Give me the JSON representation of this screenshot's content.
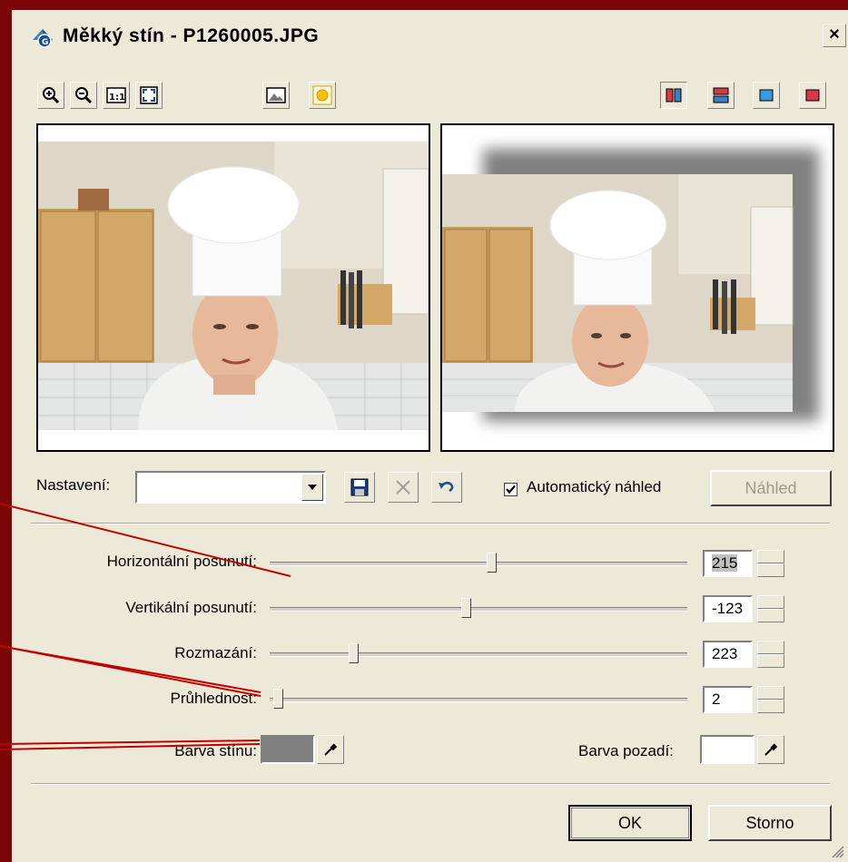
{
  "window": {
    "title": "Měkký stín - P1260005.JPG",
    "close_label": "×"
  },
  "settings": {
    "label": "Nastavení:",
    "preset_value": "",
    "auto_preview_label": "Automatický náhled",
    "auto_preview_checked": true,
    "preview_button": "Náhled"
  },
  "sliders": [
    {
      "label": "Horizontální posunutí:",
      "value": "215",
      "level": 0.53
    },
    {
      "label": "Vertikální posunutí:",
      "value": "-123",
      "level": 0.47
    },
    {
      "label": "Rozmazání:",
      "value": "223",
      "level": 0.2
    },
    {
      "label": "Průhlednost:",
      "value": "2",
      "level": 0.02
    }
  ],
  "colors": {
    "shadow_label": "Barva stínu:",
    "shadow_color": "#808080",
    "background_label": "Barva pozadí:",
    "background_color": "#ffffff"
  },
  "buttons": {
    "ok": "OK",
    "cancel": "Storno"
  },
  "theme": {
    "desktop": "#7b0606",
    "dialog": "#ece9d8",
    "annotation_line": "#c00000"
  }
}
